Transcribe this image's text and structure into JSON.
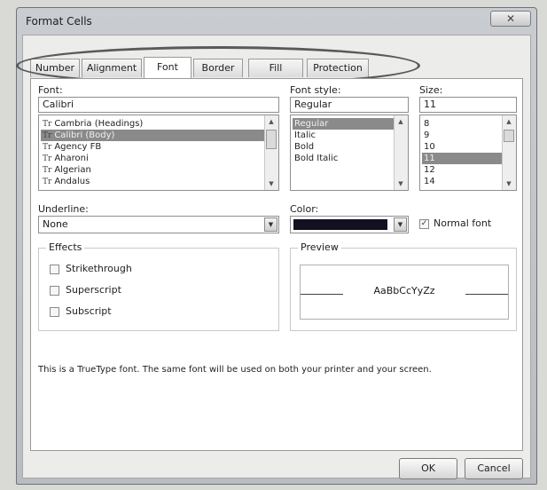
{
  "window": {
    "title": "Format Cells",
    "close_glyph": "✕"
  },
  "tabs": [
    {
      "label": "Number",
      "active": false
    },
    {
      "label": "Alignment",
      "active": false
    },
    {
      "label": "Font",
      "active": true
    },
    {
      "label": "Border",
      "active": false
    },
    {
      "label": "Fill",
      "active": false
    },
    {
      "label": "Protection",
      "active": false
    }
  ],
  "font": {
    "label": "Font:",
    "value": "Calibri",
    "items": [
      "Cambria (Headings)",
      "Calibri (Body)",
      "Agency FB",
      "Aharoni",
      "Algerian",
      "Andalus"
    ],
    "selected_index": 1,
    "tt_glyph": "Tr"
  },
  "font_style": {
    "label": "Font style:",
    "value": "Regular",
    "items": [
      "Regular",
      "Italic",
      "Bold",
      "Bold Italic"
    ],
    "selected_index": 0
  },
  "size": {
    "label": "Size:",
    "value": "11",
    "items": [
      "8",
      "9",
      "10",
      "11",
      "12",
      "14"
    ],
    "selected_index": 3
  },
  "underline": {
    "label": "Underline:",
    "value": "None"
  },
  "color": {
    "label": "Color:",
    "swatch": "#111122"
  },
  "normal_font": {
    "label": "Normal font",
    "checked": true
  },
  "effects": {
    "title": "Effects",
    "items": [
      "Strikethrough",
      "Superscript",
      "Subscript"
    ]
  },
  "preview": {
    "title": "Preview",
    "sample": "AaBbCcYyZz"
  },
  "info_text": "This is a TrueType font.  The same font will be used on both your printer and your screen.",
  "buttons": {
    "ok": "OK",
    "cancel": "Cancel"
  },
  "icons": {
    "dropdown": "▼",
    "scroll_up": "▲",
    "scroll_down": "▼",
    "check": "✓"
  }
}
